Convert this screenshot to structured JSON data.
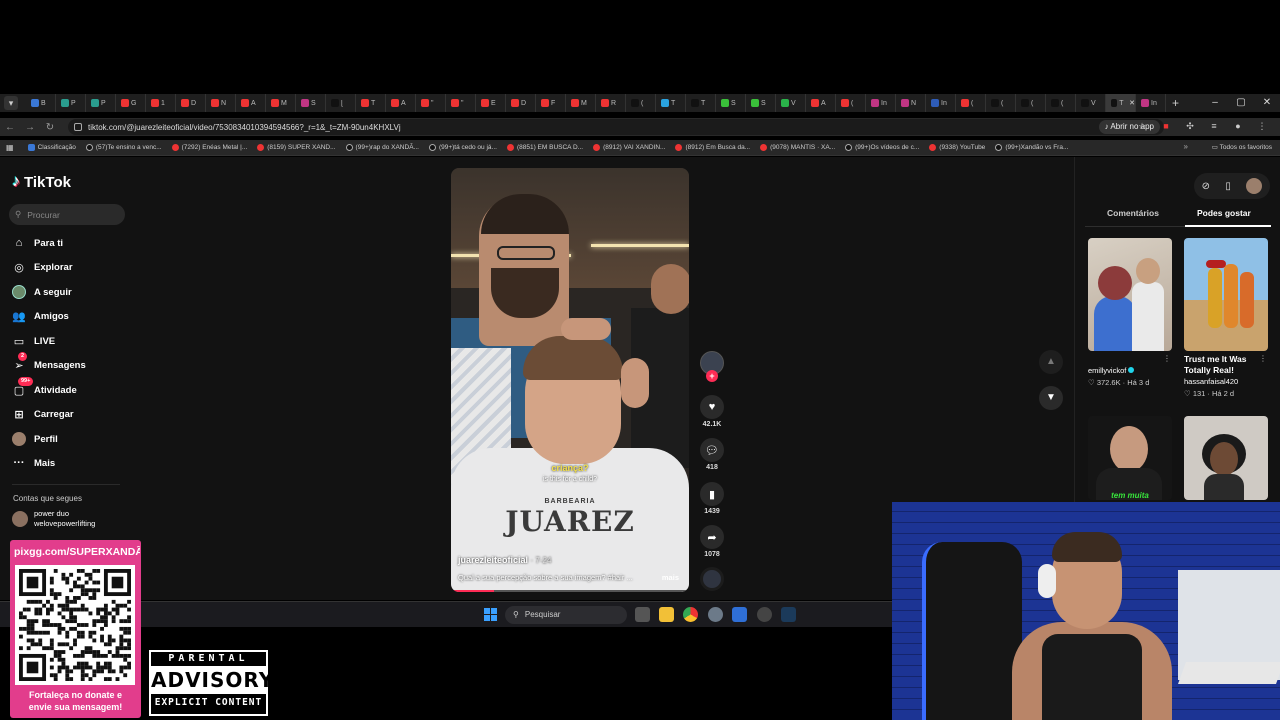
{
  "browser": {
    "tab_labels": [
      "B",
      "P",
      "P",
      "G",
      "1",
      "D",
      "N",
      "A",
      "M",
      "S",
      "[",
      "T",
      "A",
      "\"",
      "\"",
      "E",
      "D",
      "F",
      "M",
      "R",
      "(",
      "T",
      "T",
      "S",
      "S",
      "V",
      "A",
      "(",
      "In",
      "N",
      "In",
      "(",
      "(",
      "(",
      "(",
      "V",
      "T",
      "In"
    ],
    "active_tab_index": 36,
    "url": "tiktok.com/@juarezleiteoficial/video/7530834010394594566?_r=1&_t=ZM-90un4KHXLVj",
    "open_app_label": "Abrir no app",
    "bookmarks": [
      {
        "label": "Classificação",
        "icon": "classificacao"
      },
      {
        "label": "(57)Te ensino a venc...",
        "icon": "tiktok"
      },
      {
        "label": "(7292) Enéas Metal |...",
        "icon": "youtube"
      },
      {
        "label": "(8159) SUPER XAND...",
        "icon": "youtube"
      },
      {
        "label": "(99+)rap do XANDÃ...",
        "icon": "tiktok"
      },
      {
        "label": "(99+)tá cedo ou já...",
        "icon": "tiktok"
      },
      {
        "label": "(8851) EM BUSCA D...",
        "icon": "youtube"
      },
      {
        "label": "(8912) VAI XANDIN...",
        "icon": "youtube"
      },
      {
        "label": "(8912) Em Busca da...",
        "icon": "youtube"
      },
      {
        "label": "(9078) MANTIS · XA...",
        "icon": "youtube"
      },
      {
        "label": "(99+)Os vídeos de c...",
        "icon": "tiktok"
      },
      {
        "label": "(9338) YouTube",
        "icon": "youtube"
      },
      {
        "label": "(99+)Xandão vs Fra...",
        "icon": "tiktok"
      }
    ],
    "all_bookmarks_label": "Todos os favoritos"
  },
  "tiktok": {
    "logo_text": "TikTok",
    "search_placeholder": "Procurar",
    "nav": {
      "for_you": "Para ti",
      "explore": "Explorar",
      "following": "A seguir",
      "friends": "Amigos",
      "live": "LIVE",
      "messages": "Mensagens",
      "messages_badge": "2",
      "activity": "Atividade",
      "activity_badge": "99+",
      "upload": "Carregar",
      "profile": "Perfil",
      "more": "Mais"
    },
    "following_title": "Contas que segues",
    "followed_account": {
      "name": "power duo",
      "handle": "welovepowerlifting"
    },
    "video": {
      "caption_pt": "criança?",
      "caption_en": "is this for a child?",
      "brand_small": "BARBEARIA",
      "brand_big": "JUAREZ",
      "author": "juarezleiteoficial",
      "date": "· 7-24",
      "description": "Qual a sua percepção sobre a sua imagem? #hair ...",
      "more_label": "mais",
      "progress": 0.18
    },
    "actions": {
      "likes": "42.1K",
      "comments": "418",
      "saves": "1439",
      "shares": "1078"
    },
    "right_panel": {
      "tab_comments": "Comentários",
      "tab_you_may_like": "Podes gostar",
      "items": [
        {
          "title": "",
          "author": "emillyvickof",
          "likes": "372.6K",
          "age": "Há 3 d"
        },
        {
          "title": "Trust me It Was Totally Real!",
          "author": "hassanfaisal420",
          "likes": "131",
          "age": "Há 2 d"
        },
        {
          "overlay_text": "tem muita"
        },
        {
          "overlay_text": ""
        }
      ]
    }
  },
  "taskbar": {
    "search_placeholder": "Pesquisar"
  },
  "stream": {
    "donate_url": "pixgg.com/SUPERXANDÃ",
    "donate_caption_1": "Fortaleça no donate e",
    "donate_caption_2": "envie sua mensagem!",
    "advisory_top": "PARENTAL",
    "advisory_main": "ADVISORY",
    "advisory_bottom": "EXPLICIT CONTENT"
  },
  "colors": {
    "tiktok_red": "#fe2c55",
    "tiktok_cyan": "#25f4ee",
    "donate_pink": "#e23d8c",
    "taskbar_blue": "#3aa0ff"
  }
}
